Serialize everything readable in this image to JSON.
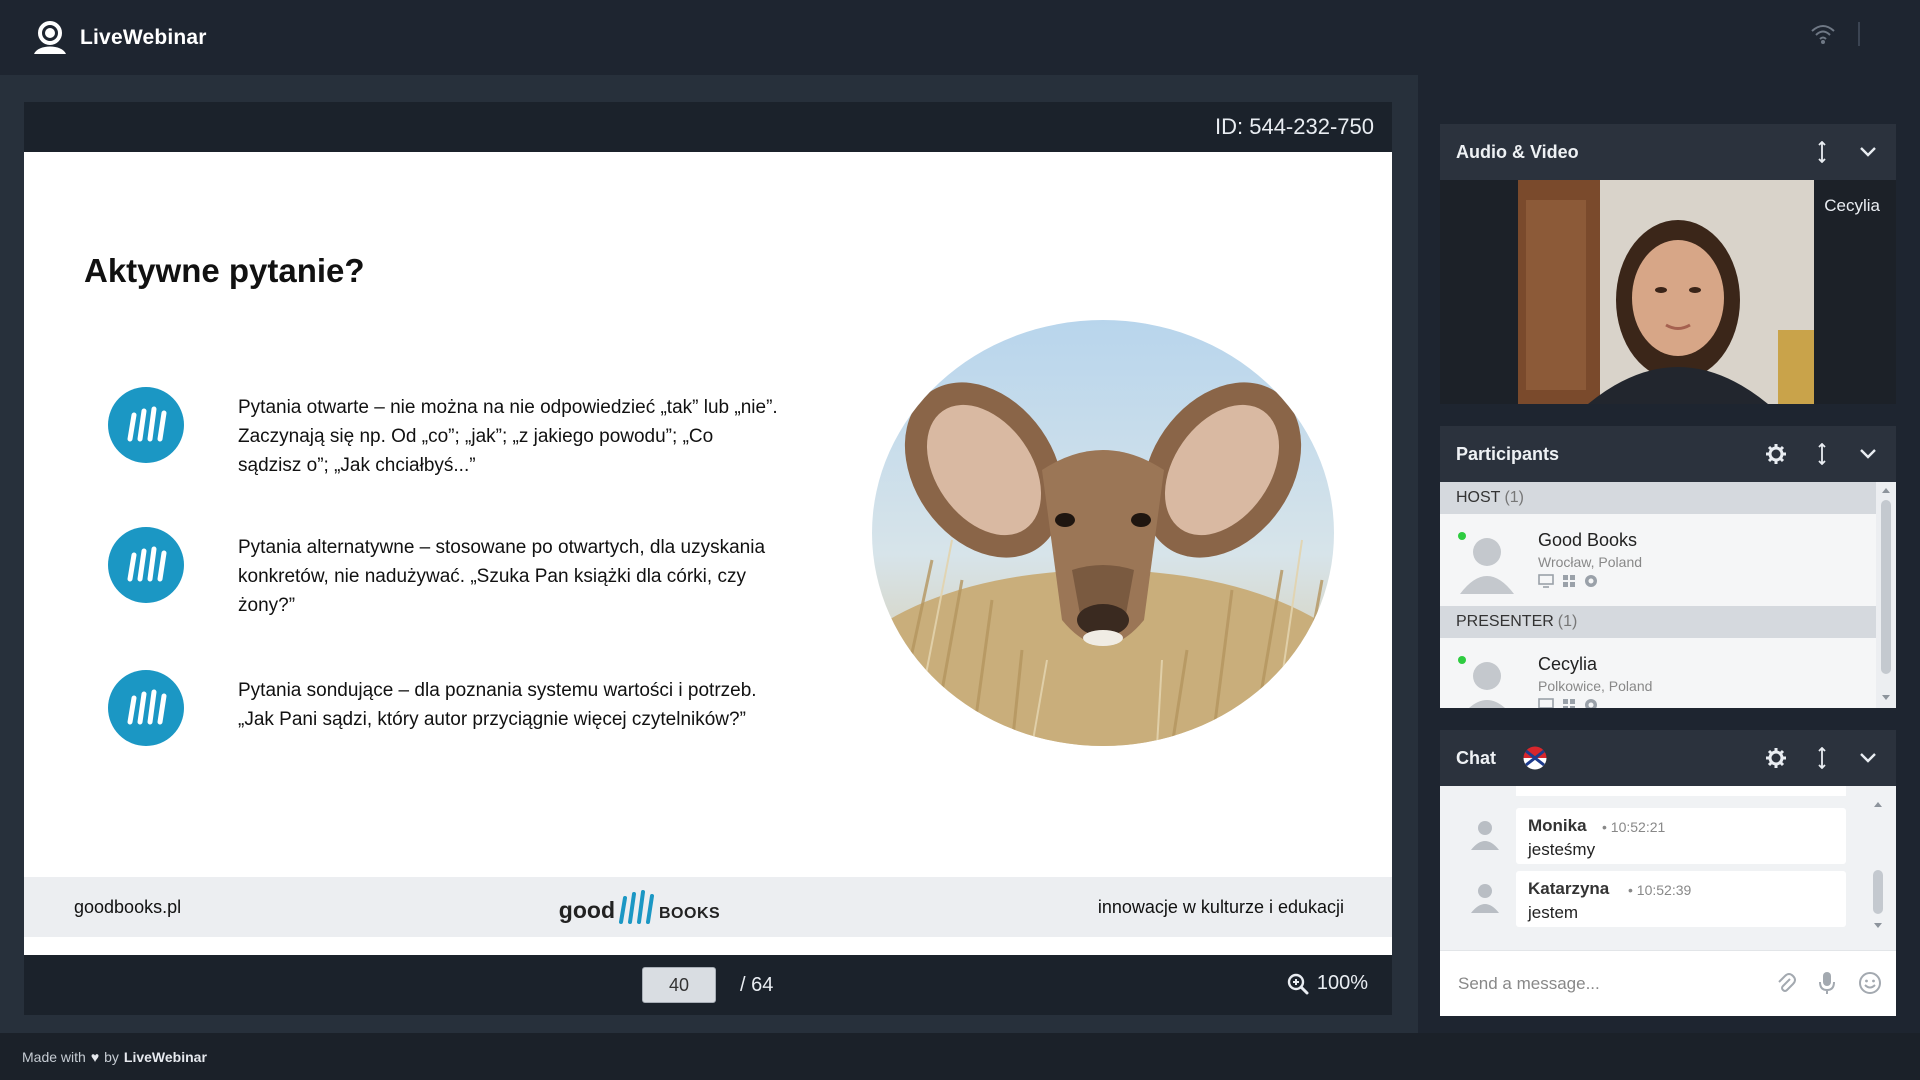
{
  "app": {
    "brand": "LiveWebinar"
  },
  "stage": {
    "webinar_id": "ID: 544-232-750",
    "slide": {
      "title": "Aktywne pytanie?",
      "points": [
        {
          "text": "Pytania otwarte – nie można na nie odpowiedzieć „tak” lub „nie”. Zaczynają się np. Od „co”; „jak”; „z jakiego powodu”; „Co sądzisz o”; „Jak chciałbyś...”"
        },
        {
          "text": "Pytania alternatywne – stosowane po otwartych, dla uzyskania konkretów, nie nadużywać. „Szuka Pan książki dla córki, czy żony?”"
        },
        {
          "text": "Pytania sondujące – dla poznania systemu wartości i potrzeb. „Jak Pani sądzi, który autor przyciągnie więcej czytelników?”"
        }
      ],
      "footer": {
        "left": "goodbooks.pl",
        "logo_part1": "good",
        "logo_part2": "books",
        "right": "innowacje w kulturze i edukacji"
      }
    },
    "controls": {
      "current_page": "40",
      "total_pages": "/ 64",
      "zoom": "100%"
    }
  },
  "footer": {
    "made_with": "Made with",
    "by": "by",
    "brand": "LiveWebinar"
  },
  "audio_video": {
    "title": "Audio & Video",
    "presenter_name": "Cecylia"
  },
  "participants": {
    "title": "Participants",
    "groups": [
      {
        "label": "HOST",
        "count": "(1)",
        "person": {
          "name": "Good Books",
          "location": "Wrocław, Poland"
        }
      },
      {
        "label": "PRESENTER",
        "count": "(1)",
        "person": {
          "name": "Cecylia",
          "location": "Polkowice, Poland"
        }
      }
    ]
  },
  "chat": {
    "title": "Chat",
    "messages": [
      {
        "name": "Monika",
        "time": "• 10:52:21",
        "text": "jesteśmy"
      },
      {
        "name": "Katarzyna",
        "time": "• 10:52:39",
        "text": "jestem"
      }
    ],
    "input_placeholder": "Send a message..."
  },
  "colors": {
    "background": "#1e2530",
    "panel_header": "#2b323d",
    "accent_badge": "#1b97c4",
    "online": "#2ecc40"
  }
}
